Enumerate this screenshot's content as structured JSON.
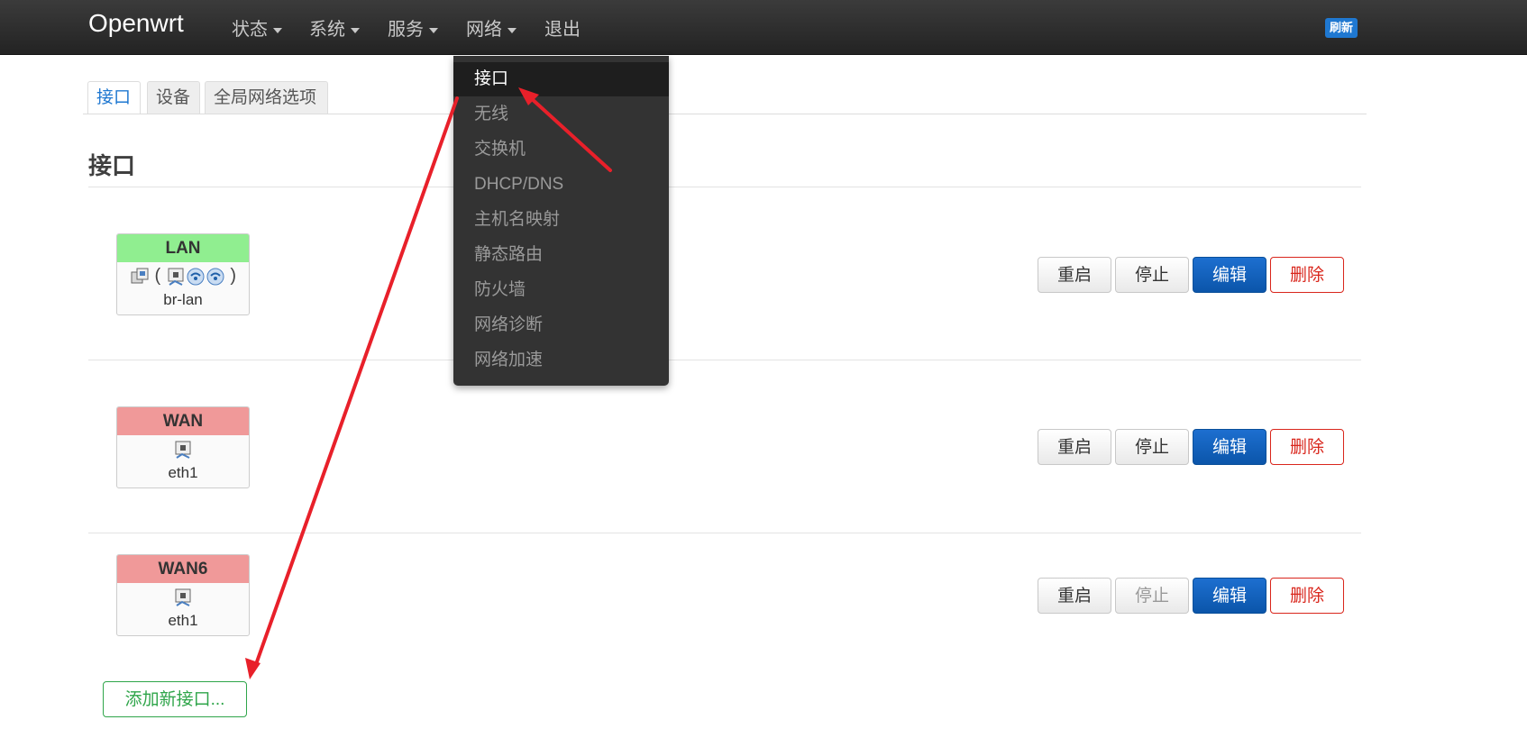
{
  "navbar": {
    "brand": "Openwrt",
    "items": [
      {
        "label": "状态"
      },
      {
        "label": "系统"
      },
      {
        "label": "服务"
      },
      {
        "label": "网络"
      },
      {
        "label": "退出"
      }
    ],
    "refresh_label": "刷新"
  },
  "tabs": [
    {
      "label": "接口",
      "active": true
    },
    {
      "label": "设备",
      "active": false
    },
    {
      "label": "全局网络选项",
      "active": false
    }
  ],
  "section_title": "接口",
  "interfaces": [
    {
      "name": "LAN",
      "device": "br-lan",
      "header_color": "#90ee90",
      "icons": [
        "switch-icon",
        "port-icon",
        "wifi-icon",
        "wifi-icon"
      ]
    },
    {
      "name": "WAN",
      "device": "eth1",
      "header_color": "#f09999",
      "icons": [
        "port-icon"
      ]
    },
    {
      "name": "WAN6",
      "device": "eth1",
      "header_color": "#f09999",
      "icons": [
        "port-icon"
      ]
    }
  ],
  "buttons": {
    "restart": "重启",
    "stop": "停止",
    "edit": "编辑",
    "delete": "删除"
  },
  "add_interface": "添加新接口...",
  "dropdown": {
    "items": [
      {
        "label": "接口",
        "active": true
      },
      {
        "label": "无线"
      },
      {
        "label": "交换机"
      },
      {
        "label": "DHCP/DNS"
      },
      {
        "label": "主机名映射"
      },
      {
        "label": "静态路由"
      },
      {
        "label": "防火墙"
      },
      {
        "label": "网络诊断"
      },
      {
        "label": "网络加速"
      }
    ]
  },
  "colors": {
    "primary": "#1f78d1",
    "danger": "#d9261c",
    "success": "#2fa54a",
    "annotation": "#e8202a"
  }
}
